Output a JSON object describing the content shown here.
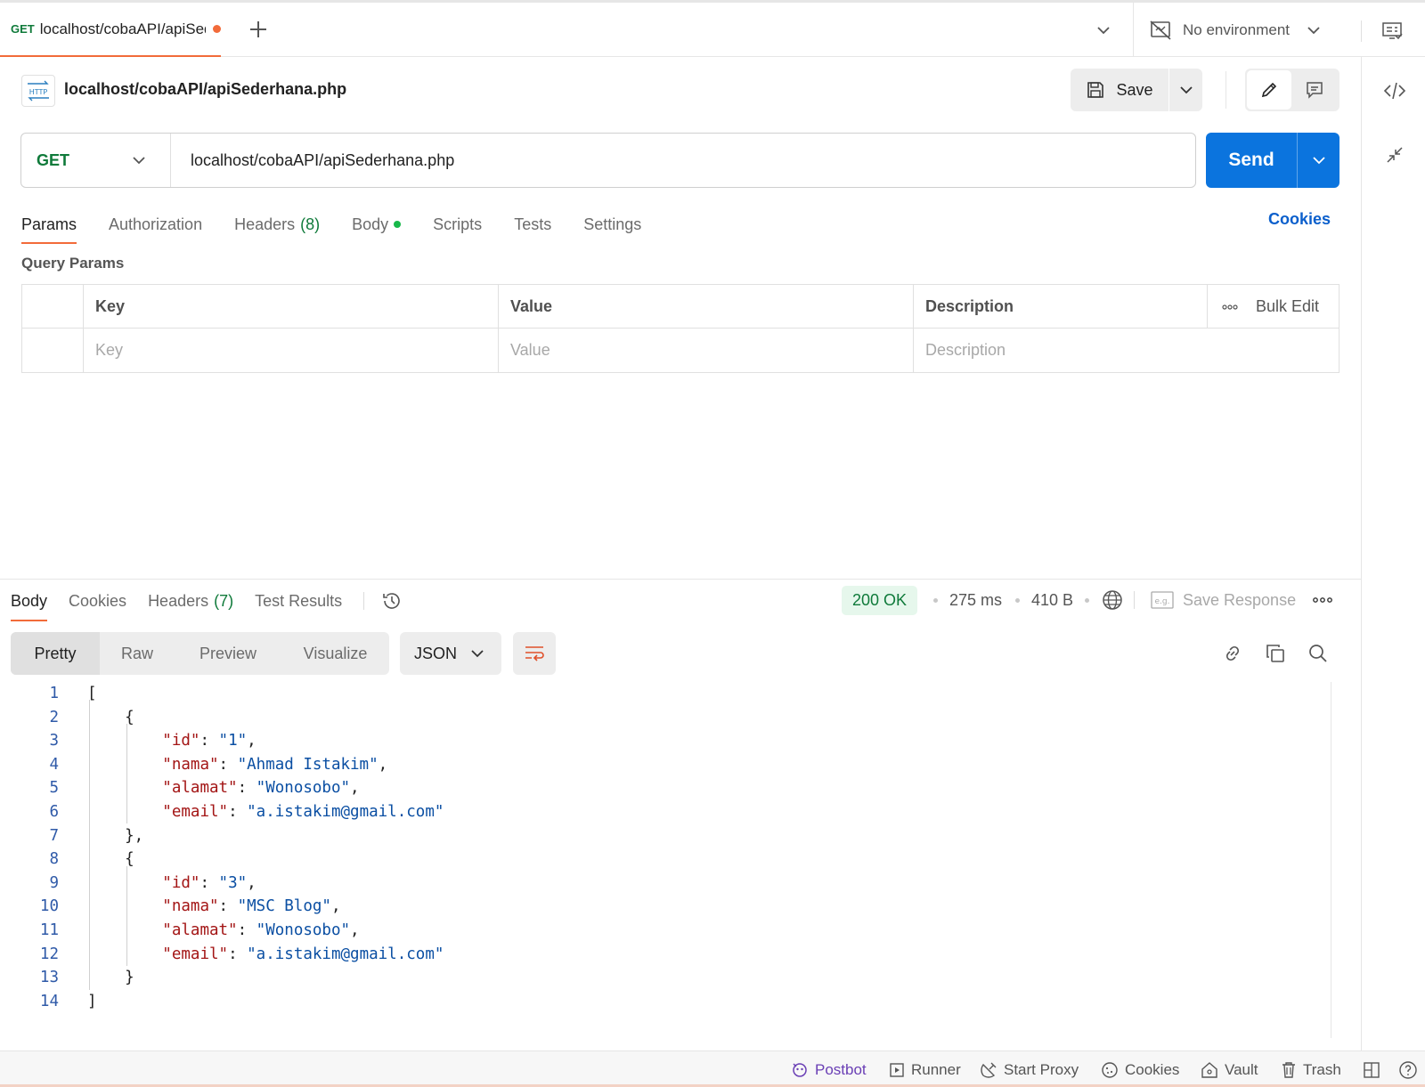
{
  "tab": {
    "method": "GET",
    "title": "localhost/cobaAPI/apiSederhana.php",
    "unsaved": true
  },
  "environment": {
    "label": "No environment"
  },
  "request": {
    "title": "localhost/cobaAPI/apiSederhana.php",
    "save_label": "Save",
    "method": "GET",
    "url": "localhost/cobaAPI/apiSederhana.php",
    "send_label": "Send",
    "http_badge": "HTTP"
  },
  "request_tabs": [
    {
      "label": "Params",
      "count": ""
    },
    {
      "label": "Authorization",
      "count": ""
    },
    {
      "label": "Headers",
      "count": "(8)"
    },
    {
      "label": "Body",
      "count": ""
    },
    {
      "label": "Scripts",
      "count": ""
    },
    {
      "label": "Tests",
      "count": ""
    },
    {
      "label": "Settings",
      "count": ""
    }
  ],
  "cookies_link": "Cookies",
  "query_params": {
    "title": "Query Params",
    "headers": {
      "key": "Key",
      "value": "Value",
      "description": "Description",
      "bulk_edit": "Bulk Edit"
    },
    "placeholders": {
      "key": "Key",
      "value": "Value",
      "description": "Description"
    }
  },
  "response": {
    "tabs": [
      {
        "label": "Body",
        "count": ""
      },
      {
        "label": "Cookies",
        "count": ""
      },
      {
        "label": "Headers",
        "count": "(7)"
      },
      {
        "label": "Test Results",
        "count": ""
      }
    ],
    "status": "200 OK",
    "time": "275 ms",
    "size": "410 B",
    "save_response": "Save Response",
    "eg_badge": "e.g.",
    "views": [
      "Pretty",
      "Raw",
      "Preview",
      "Visualize"
    ],
    "format": "JSON",
    "lines": [
      {
        "n": "1",
        "parts": [
          [
            "p",
            "["
          ]
        ]
      },
      {
        "n": "2",
        "parts": [
          [
            "p",
            "    {"
          ]
        ]
      },
      {
        "n": "3",
        "parts": [
          [
            "p",
            "        "
          ],
          [
            "k",
            "\"id\""
          ],
          [
            "p",
            ": "
          ],
          [
            "s",
            "\"1\""
          ],
          [
            "p",
            ","
          ]
        ]
      },
      {
        "n": "4",
        "parts": [
          [
            "p",
            "        "
          ],
          [
            "k",
            "\"nama\""
          ],
          [
            "p",
            ": "
          ],
          [
            "s",
            "\"Ahmad Istakim\""
          ],
          [
            "p",
            ","
          ]
        ]
      },
      {
        "n": "5",
        "parts": [
          [
            "p",
            "        "
          ],
          [
            "k",
            "\"alamat\""
          ],
          [
            "p",
            ": "
          ],
          [
            "s",
            "\"Wonosobo\""
          ],
          [
            "p",
            ","
          ]
        ]
      },
      {
        "n": "6",
        "parts": [
          [
            "p",
            "        "
          ],
          [
            "k",
            "\"email\""
          ],
          [
            "p",
            ": "
          ],
          [
            "s",
            "\"a.istakim@gmail.com\""
          ]
        ]
      },
      {
        "n": "7",
        "parts": [
          [
            "p",
            "    },"
          ]
        ]
      },
      {
        "n": "8",
        "parts": [
          [
            "p",
            "    {"
          ]
        ]
      },
      {
        "n": "9",
        "parts": [
          [
            "p",
            "        "
          ],
          [
            "k",
            "\"id\""
          ],
          [
            "p",
            ": "
          ],
          [
            "s",
            "\"3\""
          ],
          [
            "p",
            ","
          ]
        ]
      },
      {
        "n": "10",
        "parts": [
          [
            "p",
            "        "
          ],
          [
            "k",
            "\"nama\""
          ],
          [
            "p",
            ": "
          ],
          [
            "s",
            "\"MSC Blog\""
          ],
          [
            "p",
            ","
          ]
        ]
      },
      {
        "n": "11",
        "parts": [
          [
            "p",
            "        "
          ],
          [
            "k",
            "\"alamat\""
          ],
          [
            "p",
            ": "
          ],
          [
            "s",
            "\"Wonosobo\""
          ],
          [
            "p",
            ","
          ]
        ]
      },
      {
        "n": "12",
        "parts": [
          [
            "p",
            "        "
          ],
          [
            "k",
            "\"email\""
          ],
          [
            "p",
            ": "
          ],
          [
            "s",
            "\"a.istakim@gmail.com\""
          ]
        ]
      },
      {
        "n": "13",
        "parts": [
          [
            "p",
            "    }"
          ]
        ]
      },
      {
        "n": "14",
        "parts": [
          [
            "p",
            "]"
          ]
        ]
      }
    ]
  },
  "statusbar": {
    "postbot": "Postbot",
    "runner": "Runner",
    "start_proxy": "Start Proxy",
    "cookies": "Cookies",
    "vault": "Vault",
    "trash": "Trash"
  },
  "colors": {
    "accent": "#f26b3a",
    "send": "#0b74de",
    "get": "#0f7a3a",
    "link": "#0b5fcc",
    "postbot": "#6a3fb5"
  }
}
